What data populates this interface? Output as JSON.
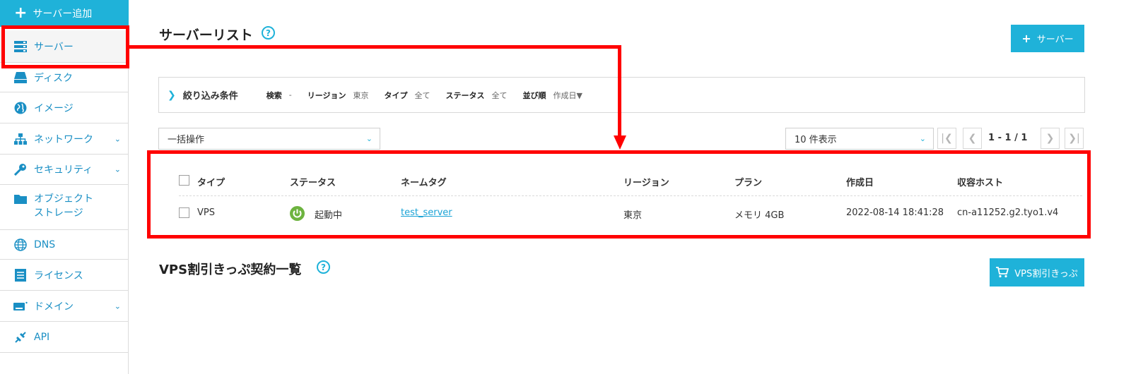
{
  "sidebar": {
    "add_button_label": "サーバー追加",
    "items": [
      {
        "label": "サーバー",
        "icon": "server-icon"
      },
      {
        "label": "ディスク",
        "icon": "disk-icon"
      },
      {
        "label": "イメージ",
        "icon": "image-globe-icon"
      },
      {
        "label": "ネットワーク",
        "icon": "network-icon"
      },
      {
        "label": "セキュリティ",
        "icon": "key-icon"
      },
      {
        "label": "オブジェクト",
        "label2": "ストレージ",
        "icon": "folder-icon"
      },
      {
        "label": "DNS",
        "icon": "globe-icon"
      },
      {
        "label": "ライセンス",
        "icon": "license-icon"
      },
      {
        "label": "ドメイン",
        "icon": "domain-icon"
      },
      {
        "label": "API",
        "icon": "api-icon"
      }
    ]
  },
  "main": {
    "title": "サーバーリスト",
    "help": "?",
    "add_server_button": "サーバー",
    "filter": {
      "title": "絞り込み条件",
      "fields": [
        {
          "key": "検索",
          "value": "-"
        },
        {
          "key": "リージョン",
          "value": "東京"
        },
        {
          "key": "タイプ",
          "value": "全て"
        },
        {
          "key": "ステータス",
          "value": "全て"
        },
        {
          "key": "並び順",
          "value": "作成日▼"
        }
      ]
    },
    "bulk_action": "一括操作",
    "per_page": "10 件表示",
    "pagination": "1 - 1 / 1",
    "table": {
      "headers": [
        "タイプ",
        "ステータス",
        "ネームタグ",
        "リージョン",
        "プラン",
        "作成日",
        "収容ホスト"
      ],
      "rows": [
        {
          "type": "VPS",
          "status": "起動中",
          "name_tag": "test_server",
          "region": "東京",
          "plan": "メモリ 4GB",
          "created": "2022-08-14 18:41:28",
          "host": "cn-a11252.g2.tyo1.v4"
        }
      ]
    },
    "vps_section_title": "VPS割引きっぷ契約一覧",
    "vps_button": "VPS割引きっぷ"
  },
  "colors": {
    "accent": "#1fb2d9",
    "link": "#1a8fc4",
    "status_running": "#6db33f",
    "annotation": "#ff0000"
  }
}
